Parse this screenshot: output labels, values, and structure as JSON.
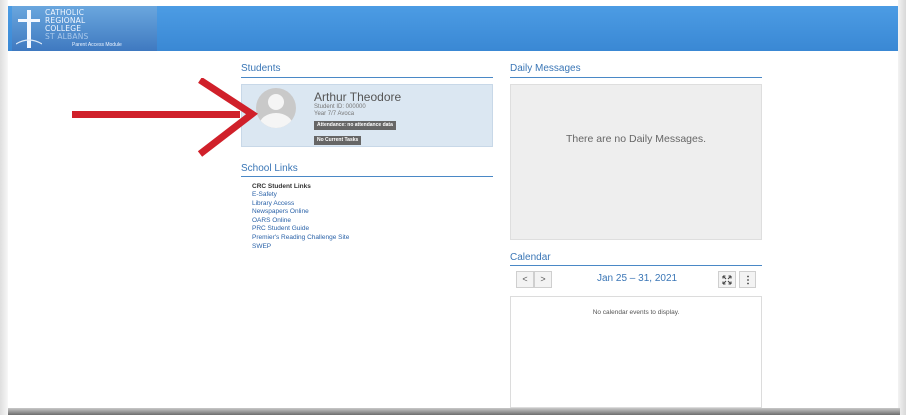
{
  "header": {
    "logo_lines": [
      "CATHOLIC",
      "REGIONAL",
      "COLLEGE",
      "ST ALBANS"
    ],
    "logo_module": "Parent Access Module"
  },
  "students": {
    "title": "Students",
    "name": "Arthur Theodore",
    "student_id": "Student ID: 000000",
    "year": "Year 7/7 Avoca",
    "attendance": "Attendance: no attendance data",
    "tasks": "No Current Tasks"
  },
  "school_links": {
    "title": "School Links",
    "heading": "CRC Student Links",
    "items": [
      "E-Safety",
      "Library Access",
      "Newspapers Online",
      "OARS Online",
      "PRC Student Guide",
      "Premier's Reading Challenge Site",
      "SWEP"
    ]
  },
  "daily_messages": {
    "title": "Daily Messages",
    "empty_text": "There are no Daily Messages."
  },
  "calendar": {
    "title": "Calendar",
    "prev_label": "<",
    "next_label": ">",
    "range": "Jan 25 – 31, 2021",
    "expand_icon": "expand-icon",
    "menu_icon": "kebab-menu-icon",
    "empty_text": "No calendar events to display."
  },
  "colors": {
    "topbar": "#3a88d4",
    "accent": "#3a76b6",
    "arrow": "#d0202a",
    "card": "#dbe7f2"
  }
}
